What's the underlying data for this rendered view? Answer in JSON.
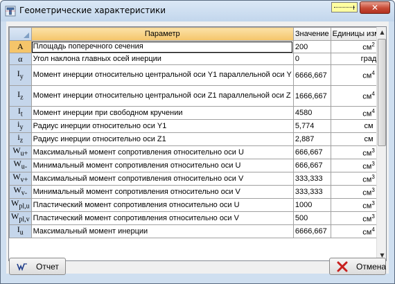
{
  "window": {
    "title": "Геометрические характеристики"
  },
  "table": {
    "headers": {
      "param": "Параметр",
      "value": "Значение",
      "units": "Единицы измерения"
    },
    "rows": [
      {
        "sym": "A",
        "sub": "",
        "name": "Площадь поперечного сечения",
        "value": "200",
        "unit": "см",
        "pow": "2"
      },
      {
        "sym": "α",
        "sub": "",
        "name": "Угол наклона главных осей инерции",
        "value": "0",
        "unit": "град",
        "pow": ""
      },
      {
        "sym": "I",
        "sub": "y",
        "name": "Момент инерции относительно центральной оси Y1 параллельной оси Y",
        "value": "6666,667",
        "unit": "см",
        "pow": "4"
      },
      {
        "sym": "I",
        "sub": "z",
        "name": "Момент инерции относительно центральной оси Z1 параллельной оси Z",
        "value": "1666,667",
        "unit": "см",
        "pow": "4"
      },
      {
        "sym": "I",
        "sub": "t",
        "name": "Момент инерции при свободном кручении",
        "value": "4580",
        "unit": "см",
        "pow": "4"
      },
      {
        "sym": "i",
        "sub": "y",
        "name": "Радиус инерции относительно оси Y1",
        "value": "5,774",
        "unit": "см",
        "pow": ""
      },
      {
        "sym": "i",
        "sub": "z",
        "name": "Радиус инерции относительно оси Z1",
        "value": "2,887",
        "unit": "см",
        "pow": ""
      },
      {
        "sym": "W",
        "sub": "u+",
        "name": "Максимальный момент сопротивления относительно оси U",
        "value": "666,667",
        "unit": "см",
        "pow": "3"
      },
      {
        "sym": "W",
        "sub": "u-",
        "name": "Минимальный момент сопротивления относительно оси U",
        "value": "666,667",
        "unit": "см",
        "pow": "3"
      },
      {
        "sym": "W",
        "sub": "v+",
        "name": "Максимальный момент сопротивления относительно оси V",
        "value": "333,333",
        "unit": "см",
        "pow": "3"
      },
      {
        "sym": "W",
        "sub": "v-",
        "name": "Минимальный момент сопротивления относительно оси V",
        "value": "333,333",
        "unit": "см",
        "pow": "3"
      },
      {
        "sym": "W",
        "sub": "pl,u",
        "name": "Пластический момент сопротивления относительно оси U",
        "value": "1000",
        "unit": "см",
        "pow": "3"
      },
      {
        "sym": "W",
        "sub": "pl,v",
        "name": "Пластический момент сопротивления относительно оси V",
        "value": "500",
        "unit": "см",
        "pow": "3"
      },
      {
        "sym": "I",
        "sub": "u",
        "name": "Максимальный момент инерции",
        "value": "6666,667",
        "unit": "см",
        "pow": "4"
      }
    ]
  },
  "buttons": {
    "report": "Отчет",
    "cancel": "Отмена"
  },
  "icons": {
    "app": "section-properties-icon",
    "ruler": "ruler-icon",
    "close": "close-icon",
    "report": "report-icon",
    "cancel": "cancel-x-icon"
  },
  "colors": {
    "header_active": "#f5c56a",
    "row_header": "#c5d6eb",
    "cancel_x": "#c8201e"
  }
}
